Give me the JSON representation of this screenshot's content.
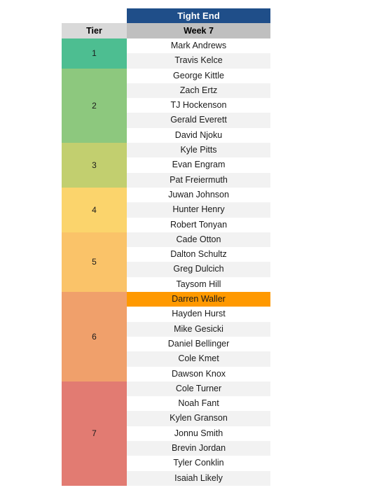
{
  "header": {
    "position_label": "Tight End",
    "tier_col_label": "Tier",
    "week_col_label": "Week 7"
  },
  "colors": {
    "position_header_bg": "#1F4E89",
    "position_header_text": "#FFFFFF",
    "tier_header_bg": "#D9D9D9",
    "week_header_bg": "#BFBFBF",
    "highlight_bg": "#FF9900",
    "row_stripe_bg": "#F2F2F2",
    "row_base_bg": "#FFFFFF"
  },
  "tiers": [
    {
      "tier": "1",
      "color": "#4DBE91",
      "players": [
        {
          "name": "Mark Andrews",
          "highlighted": false
        },
        {
          "name": "Travis Kelce",
          "highlighted": false
        }
      ]
    },
    {
      "tier": "2",
      "color": "#8DC87E",
      "players": [
        {
          "name": "George Kittle",
          "highlighted": false
        },
        {
          "name": "Zach Ertz",
          "highlighted": false
        },
        {
          "name": "TJ Hockenson",
          "highlighted": false
        },
        {
          "name": "Gerald Everett",
          "highlighted": false
        },
        {
          "name": "David Njoku",
          "highlighted": false
        }
      ]
    },
    {
      "tier": "3",
      "color": "#C2CF6F",
      "players": [
        {
          "name": "Kyle Pitts",
          "highlighted": false
        },
        {
          "name": "Evan Engram",
          "highlighted": false
        },
        {
          "name": "Pat Freiermuth",
          "highlighted": false
        }
      ]
    },
    {
      "tier": "4",
      "color": "#FBD46C",
      "players": [
        {
          "name": "Juwan Johnson",
          "highlighted": false
        },
        {
          "name": "Hunter Henry",
          "highlighted": false
        },
        {
          "name": "Robert Tonyan",
          "highlighted": false
        }
      ]
    },
    {
      "tier": "5",
      "color": "#FAC369",
      "players": [
        {
          "name": "Cade Otton",
          "highlighted": false
        },
        {
          "name": "Dalton Schultz",
          "highlighted": false
        },
        {
          "name": "Greg Dulcich",
          "highlighted": false
        },
        {
          "name": "Taysom Hill",
          "highlighted": false
        }
      ]
    },
    {
      "tier": "6",
      "color": "#F0A06B",
      "players": [
        {
          "name": "Darren Waller",
          "highlighted": true
        },
        {
          "name": "Hayden Hurst",
          "highlighted": false
        },
        {
          "name": "Mike Gesicki",
          "highlighted": false
        },
        {
          "name": "Daniel Bellinger",
          "highlighted": false
        },
        {
          "name": "Cole Kmet",
          "highlighted": false
        },
        {
          "name": "Dawson Knox",
          "highlighted": false
        }
      ]
    },
    {
      "tier": "7",
      "color": "#E27B72",
      "players": [
        {
          "name": "Cole Turner",
          "highlighted": false
        },
        {
          "name": "Noah Fant",
          "highlighted": false
        },
        {
          "name": "Kylen Granson",
          "highlighted": false
        },
        {
          "name": "Jonnu Smith",
          "highlighted": false
        },
        {
          "name": "Brevin Jordan",
          "highlighted": false
        },
        {
          "name": "Tyler Conklin",
          "highlighted": false
        },
        {
          "name": "Isaiah Likely",
          "highlighted": false
        }
      ]
    }
  ]
}
